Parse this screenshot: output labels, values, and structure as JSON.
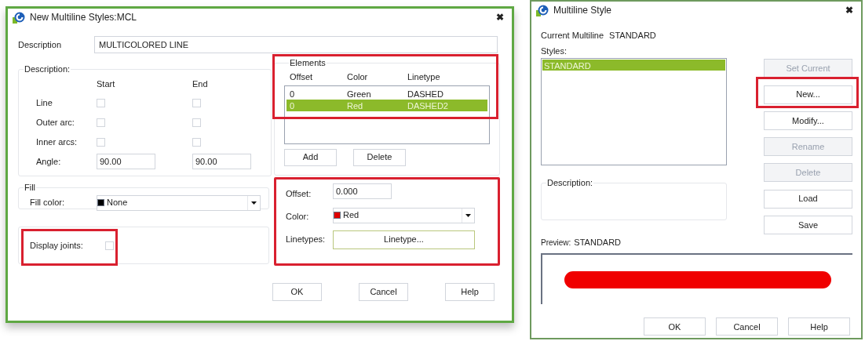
{
  "style_dialog": {
    "title": "New Multiline Styles:MCL",
    "close": "✖",
    "description": {
      "label": "Description",
      "value": "MULTICOLORED LINE"
    },
    "caps": {
      "title": "Description:",
      "columns": [
        "Start",
        "End"
      ],
      "rows": [
        {
          "label": "Line",
          "kind": "checkbox",
          "start_checked": false,
          "end_checked": false
        },
        {
          "label": "Outer arc:",
          "kind": "checkbox",
          "start_checked": false,
          "end_checked": false
        },
        {
          "label": "Inner arcs:",
          "kind": "checkbox",
          "start_checked": false,
          "end_checked": false
        },
        {
          "label": "Angle:",
          "kind": "field",
          "start_value": "90.00",
          "end_value": "90.00"
        }
      ]
    },
    "fill": {
      "title": "Fill",
      "label": "Fill color:",
      "value": "None",
      "color": "#000000"
    },
    "joints": {
      "label": "Display joints:",
      "checked": false,
      "highlighted": true
    },
    "elements": {
      "title": "Elements",
      "highlighted": true,
      "columns": [
        "Offset",
        "Color",
        "Linetype"
      ],
      "rows": [
        {
          "cells": [
            "0",
            "Green",
            "DASHED"
          ],
          "selected": false
        },
        {
          "cells": [
            "0",
            "Red",
            "DASHED2"
          ],
          "selected": true
        }
      ],
      "buttons": [
        "Add",
        "Delete"
      ]
    },
    "properties": {
      "highlighted": true,
      "offset": {
        "label": "Offset:",
        "value": "0.000"
      },
      "color": {
        "label": "Color:",
        "value": "Red",
        "color": "#e00000"
      },
      "linetype": {
        "label": "Linetypes:",
        "button": "Linetype..."
      }
    },
    "buttons": [
      "OK",
      "Cancel",
      "Help"
    ]
  },
  "multiline_dialog": {
    "title": "Multiline Style",
    "close": "✖",
    "current": {
      "label": "Current Multiline",
      "value": "STANDARD"
    },
    "styles_label": "Styles:",
    "styles": [
      {
        "name": "STANDARD",
        "selected": true
      }
    ],
    "buttons": [
      {
        "label": "Set Current",
        "disabled": true,
        "highlighted": false
      },
      {
        "label": "New...",
        "disabled": false,
        "highlighted": true
      },
      {
        "label": "Modify...",
        "disabled": false,
        "highlighted": false
      },
      {
        "label": "Rename",
        "disabled": true,
        "highlighted": false
      },
      {
        "label": "Delete",
        "disabled": true,
        "highlighted": false
      },
      {
        "label": "Load",
        "disabled": false,
        "highlighted": false
      },
      {
        "label": "Save",
        "disabled": false,
        "highlighted": false
      }
    ],
    "description_title": "Description:",
    "preview": {
      "label": "Preview:",
      "value": "STANDARD"
    },
    "buttons_footer": [
      "OK",
      "Cancel",
      "Help"
    ]
  }
}
